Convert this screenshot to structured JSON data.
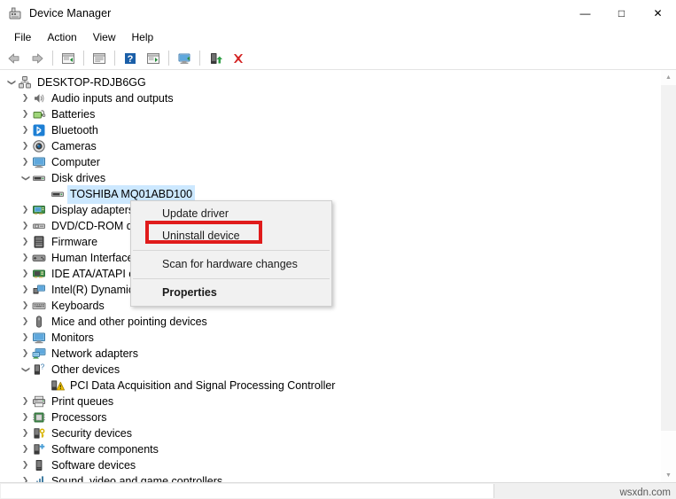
{
  "window": {
    "title": "Device Manager",
    "icon": "device-manager-icon",
    "controls": {
      "minimize": "—",
      "maximize": "□",
      "close": "✕"
    }
  },
  "menubar": {
    "items": [
      {
        "label": "File",
        "name": "menu-file"
      },
      {
        "label": "Action",
        "name": "menu-action"
      },
      {
        "label": "View",
        "name": "menu-view"
      },
      {
        "label": "Help",
        "name": "menu-help"
      }
    ]
  },
  "toolbar": {
    "buttons": [
      {
        "name": "back-icon",
        "title": "Back"
      },
      {
        "name": "forward-icon",
        "title": "Forward"
      },
      {
        "name": "separator-1",
        "title": ""
      },
      {
        "name": "show-hide-console-tree-icon",
        "title": "Show/Hide Console Tree"
      },
      {
        "name": "separator-2",
        "title": ""
      },
      {
        "name": "properties-icon",
        "title": "Properties"
      },
      {
        "name": "separator-3",
        "title": ""
      },
      {
        "name": "help-icon",
        "title": "Help"
      },
      {
        "name": "update-driver-icon",
        "title": "Update Driver"
      },
      {
        "name": "separator-4",
        "title": ""
      },
      {
        "name": "scan-hardware-changes-icon",
        "title": "Scan for hardware changes"
      },
      {
        "name": "separator-5",
        "title": ""
      },
      {
        "name": "enable-device-icon",
        "title": "Enable device"
      },
      {
        "name": "uninstall-device-icon",
        "title": "Uninstall device"
      }
    ]
  },
  "tree": {
    "nodes": [
      {
        "label": "DESKTOP-RDJB6GG",
        "level": 0,
        "state": "expanded",
        "icon": "computer-root-icon",
        "selected": false,
        "warning": false
      },
      {
        "label": "Audio inputs and outputs",
        "level": 1,
        "state": "collapsed",
        "icon": "speaker-icon",
        "selected": false,
        "warning": false
      },
      {
        "label": "Batteries",
        "level": 1,
        "state": "collapsed",
        "icon": "battery-icon",
        "selected": false,
        "warning": false
      },
      {
        "label": "Bluetooth",
        "level": 1,
        "state": "collapsed",
        "icon": "bluetooth-icon",
        "selected": false,
        "warning": false
      },
      {
        "label": "Cameras",
        "level": 1,
        "state": "collapsed",
        "icon": "camera-icon",
        "selected": false,
        "warning": false
      },
      {
        "label": "Computer",
        "level": 1,
        "state": "collapsed",
        "icon": "monitor-icon",
        "selected": false,
        "warning": false
      },
      {
        "label": "Disk drives",
        "level": 1,
        "state": "expanded",
        "icon": "disk-drive-icon",
        "selected": false,
        "warning": false
      },
      {
        "label": "TOSHIBA MQ01ABD100",
        "level": 2,
        "state": "leaf",
        "icon": "disk-drive-icon",
        "selected": true,
        "warning": false
      },
      {
        "label": "Display adapters",
        "level": 1,
        "state": "collapsed",
        "icon": "display-adapter-icon",
        "selected": false,
        "warning": false
      },
      {
        "label": "DVD/CD-ROM drives",
        "level": 1,
        "state": "collapsed",
        "icon": "dvd-drive-icon",
        "selected": false,
        "warning": false
      },
      {
        "label": "Firmware",
        "level": 1,
        "state": "collapsed",
        "icon": "firmware-icon",
        "selected": false,
        "warning": false
      },
      {
        "label": "Human Interface Devices",
        "level": 1,
        "state": "collapsed",
        "icon": "hid-icon",
        "selected": false,
        "warning": false
      },
      {
        "label": "IDE ATA/ATAPI controllers",
        "level": 1,
        "state": "collapsed",
        "icon": "ide-controller-icon",
        "selected": false,
        "warning": false
      },
      {
        "label": "Intel(R) Dynamic Platform and Thermal Framework",
        "level": 1,
        "state": "collapsed",
        "icon": "intel-device-icon",
        "selected": false,
        "warning": false
      },
      {
        "label": "Keyboards",
        "level": 1,
        "state": "collapsed",
        "icon": "keyboard-icon",
        "selected": false,
        "warning": false
      },
      {
        "label": "Mice and other pointing devices",
        "level": 1,
        "state": "collapsed",
        "icon": "mouse-icon",
        "selected": false,
        "warning": false
      },
      {
        "label": "Monitors",
        "level": 1,
        "state": "collapsed",
        "icon": "monitor-icon",
        "selected": false,
        "warning": false
      },
      {
        "label": "Network adapters",
        "level": 1,
        "state": "collapsed",
        "icon": "network-adapter-icon",
        "selected": false,
        "warning": false
      },
      {
        "label": "Other devices",
        "level": 1,
        "state": "expanded",
        "icon": "other-device-icon",
        "selected": false,
        "warning": false
      },
      {
        "label": "PCI Data Acquisition and Signal Processing Controller",
        "level": 2,
        "state": "leaf",
        "icon": "unknown-device-icon",
        "selected": false,
        "warning": true
      },
      {
        "label": "Print queues",
        "level": 1,
        "state": "collapsed",
        "icon": "printer-icon",
        "selected": false,
        "warning": false
      },
      {
        "label": "Processors",
        "level": 1,
        "state": "collapsed",
        "icon": "processor-icon",
        "selected": false,
        "warning": false
      },
      {
        "label": "Security devices",
        "level": 1,
        "state": "collapsed",
        "icon": "security-device-icon",
        "selected": false,
        "warning": false
      },
      {
        "label": "Software components",
        "level": 1,
        "state": "collapsed",
        "icon": "software-component-icon",
        "selected": false,
        "warning": false
      },
      {
        "label": "Software devices",
        "level": 1,
        "state": "collapsed",
        "icon": "software-device-icon",
        "selected": false,
        "warning": false
      },
      {
        "label": "Sound, video and game controllers",
        "level": 1,
        "state": "collapsed",
        "icon": "sound-device-icon",
        "selected": false,
        "warning": false
      }
    ]
  },
  "context_menu": {
    "items": [
      {
        "label": "Update driver",
        "bold": false,
        "type": "item",
        "name": "ctx-update-driver"
      },
      {
        "label": "Uninstall device",
        "bold": false,
        "type": "item",
        "name": "ctx-uninstall-device",
        "highlighted": true
      },
      {
        "label": "",
        "type": "separator",
        "name": "ctx-separator-1"
      },
      {
        "label": "Scan for hardware changes",
        "bold": false,
        "type": "item",
        "name": "ctx-scan-hardware-changes"
      },
      {
        "label": "",
        "type": "separator",
        "name": "ctx-separator-2"
      },
      {
        "label": "Properties",
        "bold": true,
        "type": "item",
        "name": "ctx-properties"
      }
    ],
    "highlight_color": "#e01b1b"
  },
  "scrollbars": {
    "vertical_arrow_up": "▲",
    "vertical_arrow_down": "▼"
  },
  "watermark": {
    "text": "wsxdn.com"
  },
  "colors": {
    "selection": "#cce8ff",
    "annotation_red": "#e01b1b",
    "menu_bg": "#f1f1f1",
    "window_bg": "#ffffff"
  }
}
